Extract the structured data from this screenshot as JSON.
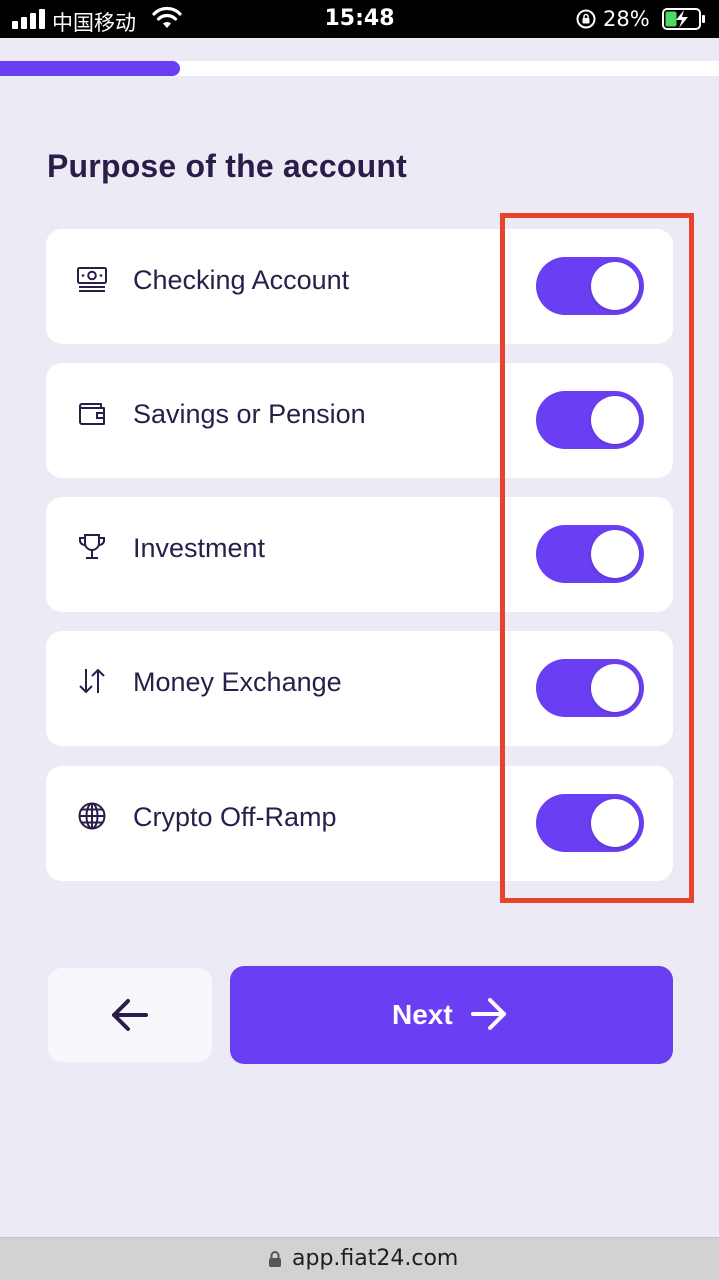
{
  "status_bar": {
    "carrier": "中国移动",
    "time": "15:48",
    "battery_percent": "28%"
  },
  "progress": {
    "fraction": 0.25
  },
  "page": {
    "title": "Purpose of the account"
  },
  "options": [
    {
      "label": "Checking Account",
      "icon": "banknote-icon",
      "enabled": true
    },
    {
      "label": "Savings or Pension",
      "icon": "wallet-icon",
      "enabled": true
    },
    {
      "label": "Investment",
      "icon": "trophy-icon",
      "enabled": true
    },
    {
      "label": "Money Exchange",
      "icon": "exchange-arrows-icon",
      "enabled": true
    },
    {
      "label": "Crypto Off-Ramp",
      "icon": "globe-icon",
      "enabled": true
    }
  ],
  "actions": {
    "back_icon": "arrow-left-icon",
    "next_label": "Next",
    "next_icon": "arrow-right-icon"
  },
  "browser": {
    "url": "app.fiat24.com"
  },
  "colors": {
    "accent": "#6a3ef2",
    "background": "#ecebf5",
    "text": "#2a1d4a",
    "highlight": "#e8412c"
  }
}
